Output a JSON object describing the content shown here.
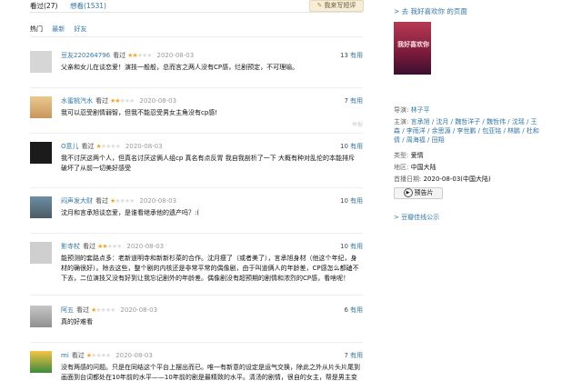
{
  "tabs": {
    "seen": "看过(27)",
    "want": "想看(1531)",
    "write": "我来写短评"
  },
  "filters": [
    "热门",
    "最新",
    "好友"
  ],
  "comments": [
    {
      "user": "豆友220264796",
      "status": "看过",
      "stars": 2,
      "date": "2020-08-03",
      "useful": "13",
      "useful_label": "有用",
      "text": "父亲和女儿在谈恋爱！演技一般般，总而言之两人没有CP感，烂剧预定，不可理喻。",
      "avatar": "default-avatar"
    },
    {
      "user": "水蜜桃汽水",
      "status": "看过",
      "stars": 2,
      "date": "2020-08-03",
      "useful": "7",
      "useful_label": "有用",
      "text": "我可以忍受剧情弱智，但我不能忍受男女主角没有cp感!",
      "avatar": "blonde-girl-avatar",
      "report": "举报"
    },
    {
      "user": "O意儿",
      "status": "看过",
      "stars": 1,
      "date": "2020-08-03",
      "useful": "10",
      "useful_label": "有用",
      "text": "我不讨厌这两个人，但真名讨厌这俩人组cp 真名有点反胃 我自我剖析了一下 大概有种对乱伦的本能排斥 破坏了从前一切美好感受",
      "avatar": "dark-avatar"
    },
    {
      "user": "闷声发大财",
      "status": "看过",
      "stars": 1,
      "date": "2020-08-03",
      "useful": "10",
      "useful_label": "有用",
      "text": "沈月和言承旭谈恋爱，是谁看继承他的遗产吗？:(",
      "avatar": "photo-avatar"
    },
    {
      "user": "影寺杖",
      "status": "看过",
      "stars": 2,
      "date": "2020-08-03",
      "useful": "10",
      "useful_label": "有用",
      "text": "能预测的套路点多：老新道明寺和新新杉菜的合作。沈月瘦了（或者美了），言承旭身材（他这个年纪，身材的确很好）。除去这些，整个剧的内核还是非常平常的偶像剧，由于叫道俩人的年龄差，CP感怎么都磕不下去，二位演技又没有好到让我忘记剧外的年龄差。偶像剧没有超预期的剧情和浓烈的CP感，看啥呢！",
      "avatar": "default-avatar"
    },
    {
      "user": "阿五",
      "status": "看过",
      "stars": 1,
      "date": "2020-08-03",
      "useful": "6",
      "useful_label": "有用",
      "text": "真的好难看",
      "avatar": "elder-avatar"
    },
    {
      "user": "mi",
      "status": "看过",
      "stars": 1,
      "date": "2020-08-03",
      "useful": "7",
      "useful_label": "有用",
      "text": "没有两感的问题。只是在同结这个平台上摆出而已。唯一有新意的设定是运气交换，除此之外从片头片尾到画面到台词都处在10年前的水平——10年前的剧是最精致的水平。清汤的剧情，很自的女主，帮是男主变了",
      "avatar": "cartoon-avatar"
    }
  ],
  "sidebar": {
    "back_link": "> 去 我好喜欢你 的页面",
    "poster_caption": "我好喜欢你",
    "director_label": "导演:",
    "director": "林子平",
    "cast_label": "主演:",
    "cast": "言承旭 / 沈月 / 魏哲洋子 / 魏哲伟 / 沈瑶 / 王森 / 李雨洋 / 余思源 / 李世鹏 / 包亚铭 / 林鹏 / 杜和倩 / 周海福 / 田翔",
    "genre_label": "类型:",
    "genre": "爱情",
    "region_label": "地区:",
    "region": "中国大陆",
    "release_label": "首播日期:",
    "release": "2020-08-03(中国大陆)",
    "trailer": "预告片",
    "douban_link": "> 豆瓣佳线公示"
  }
}
